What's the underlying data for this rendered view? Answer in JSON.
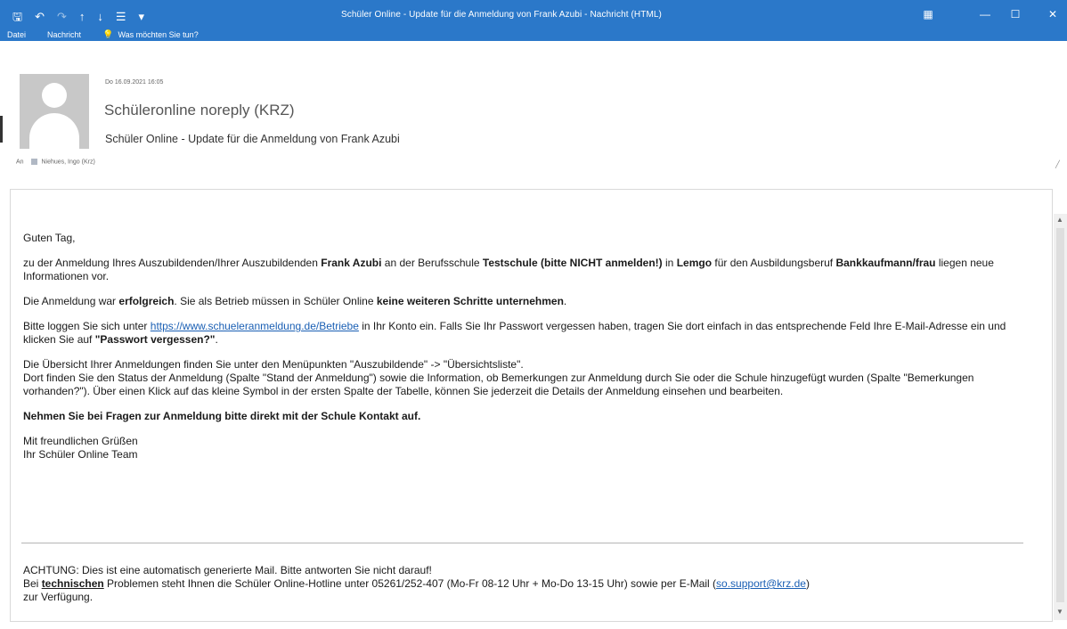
{
  "window": {
    "title": "Schüler Online - Update für die Anmeldung von Frank Azubi - Nachricht (HTML)",
    "colors": {
      "titlebar": "#2b78c9",
      "link": "#1a5fb4"
    }
  },
  "qat": {
    "save_icon": "save-icon",
    "undo_icon": "undo-icon",
    "redo_icon": "redo-icon",
    "up_icon": "up-arrow-icon",
    "down_icon": "down-arrow-icon",
    "move_icon": "move-icon",
    "customize_icon": "customize-icon"
  },
  "ribbon": {
    "tabs": [
      "Datei",
      "Nachricht"
    ],
    "tellme": "Was möchten Sie tun?"
  },
  "header": {
    "date": "Do 16.09.2021 16:05",
    "sender": "Schüleronline noreply (KRZ)",
    "subject": "Schüler Online - Update für die Anmeldung von Frank Azubi",
    "to_label": "An",
    "to_value": "Niehues, Ingo (Krz)"
  },
  "body": {
    "greeting": "Guten Tag,",
    "p1_a": "zu der Anmeldung Ihres Auszubildenden/Ihrer Auszubildenden ",
    "p1_name": "Frank Azubi",
    "p1_b": " an der Berufsschule ",
    "p1_school": "Testschule (bitte NICHT anmelden!)",
    "p1_c": " in ",
    "p1_city": "Lemgo",
    "p1_d": " für den Ausbildungsberuf ",
    "p1_job": "Bankkaufmann/frau",
    "p1_e": " liegen neue Informationen vor.",
    "p2_a": "Die Anmeldung war ",
    "p2_b": "erfolgreich",
    "p2_c": ". Sie als Betrieb müssen in Schüler Online ",
    "p2_d": "keine weiteren Schritte unternehmen",
    "p2_e": ".",
    "p3_a": "Bitte loggen Sie sich unter ",
    "p3_link": "https://www.schueleranmeldung.de/Betriebe",
    "p3_b": " in Ihr Konto ein. Falls Sie Ihr Passwort vergessen haben, tragen Sie dort einfach in das entsprechende Feld Ihre E-Mail-Adresse ein und klicken Sie auf ",
    "p3_c": "\"Passwort vergessen?\"",
    "p3_d": ".",
    "p4_line1": "Die Übersicht Ihrer Anmeldungen finden Sie unter den Menüpunkten \"Auszubildende\" -> \"Übersichtsliste\".",
    "p4_line2": "Dort finden Sie den Status der Anmeldung (Spalte \"Stand der Anmeldung\") sowie die Information, ob Bemerkungen zur Anmeldung durch Sie oder die Schule hinzugefügt wurden (Spalte \"Bemerkungen vorhanden?\"). Über einen Klick auf das kleine Symbol in der ersten Spalte der Tabelle, können Sie jederzeit die Details der Anmeldung einsehen und bearbeiten.",
    "p5": "Nehmen Sie bei Fragen zur Anmeldung bitte direkt mit der Schule Kontakt auf.",
    "closing1": "Mit freundlichen Grüßen",
    "closing2": "Ihr Schüler Online Team"
  },
  "footer": {
    "line1": "ACHTUNG: Dies ist eine automatisch generierte Mail. Bitte antworten Sie nicht darauf!",
    "l2_a": "Bei ",
    "l2_tech": "technischen",
    "l2_b": " Problemen steht Ihnen die Schüler Online-Hotline unter 05261/252-407 (Mo-Fr 08-12 Uhr + Mo-Do 13-15 Uhr) sowie per E-Mail (",
    "l2_mail": "so.support@krz.de",
    "l2_c": ")",
    "line3": "zur Verfügung."
  }
}
